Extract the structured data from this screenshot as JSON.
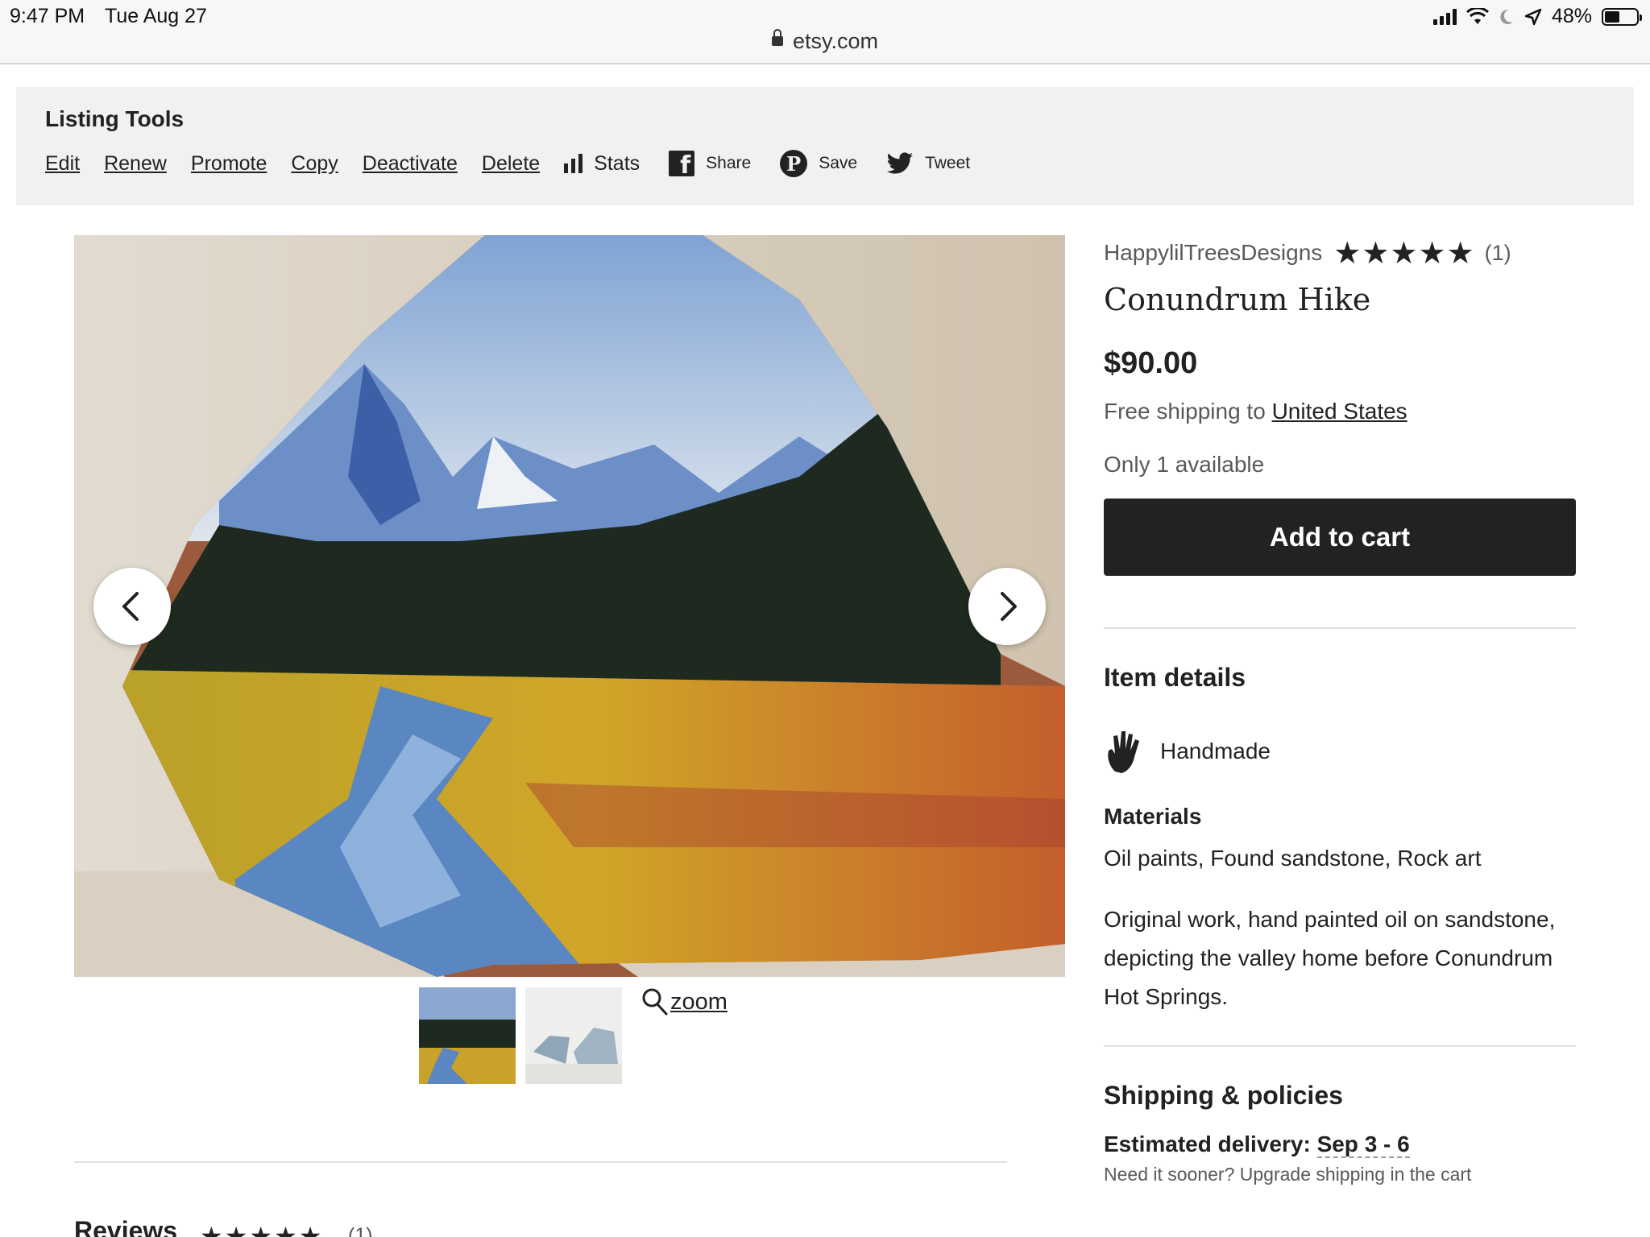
{
  "status": {
    "time": "9:47 PM",
    "date": "Tue Aug 27",
    "battery": "48%",
    "battery_level": 0.48
  },
  "browser": {
    "url": "etsy.com"
  },
  "listing_tools": {
    "title": "Listing Tools",
    "links": [
      "Edit",
      "Renew",
      "Promote",
      "Copy",
      "Deactivate",
      "Delete"
    ],
    "stats": "Stats",
    "share": "Share",
    "save": "Save",
    "tweet": "Tweet"
  },
  "gallery": {
    "zoom": "zoom",
    "thumb_count": 2
  },
  "listing": {
    "shop": "HappylilTreesDesigns",
    "stars": "★★★★★",
    "rating_count": "(1)",
    "title": "Conundrum Hike",
    "price": "$90.00",
    "shipping_prefix": "Free shipping to",
    "shipping_country": "United States",
    "availability": "Only 1 available",
    "cart_label": "Add to cart"
  },
  "item_details": {
    "title": "Item details",
    "handmade": "Handmade",
    "materials_heading": "Materials",
    "materials": "Oil paints, Found sandstone, Rock art",
    "description": "Original work, hand painted oil on sandstone, depicting the valley home before Conundrum Hot Springs."
  },
  "shipping_policies": {
    "title": "Shipping & policies",
    "delivery_label": "Estimated delivery:",
    "delivery_dates": "Sep 3 - 6",
    "sooner": "Need it sooner? Upgrade shipping in the cart"
  },
  "reviews": {
    "title": "Reviews",
    "stars": "★★★★★",
    "count": "(1)"
  },
  "colors": {
    "accent_dark": "#222222",
    "muted_text": "#595959",
    "tools_bg": "#f1f1f1"
  }
}
